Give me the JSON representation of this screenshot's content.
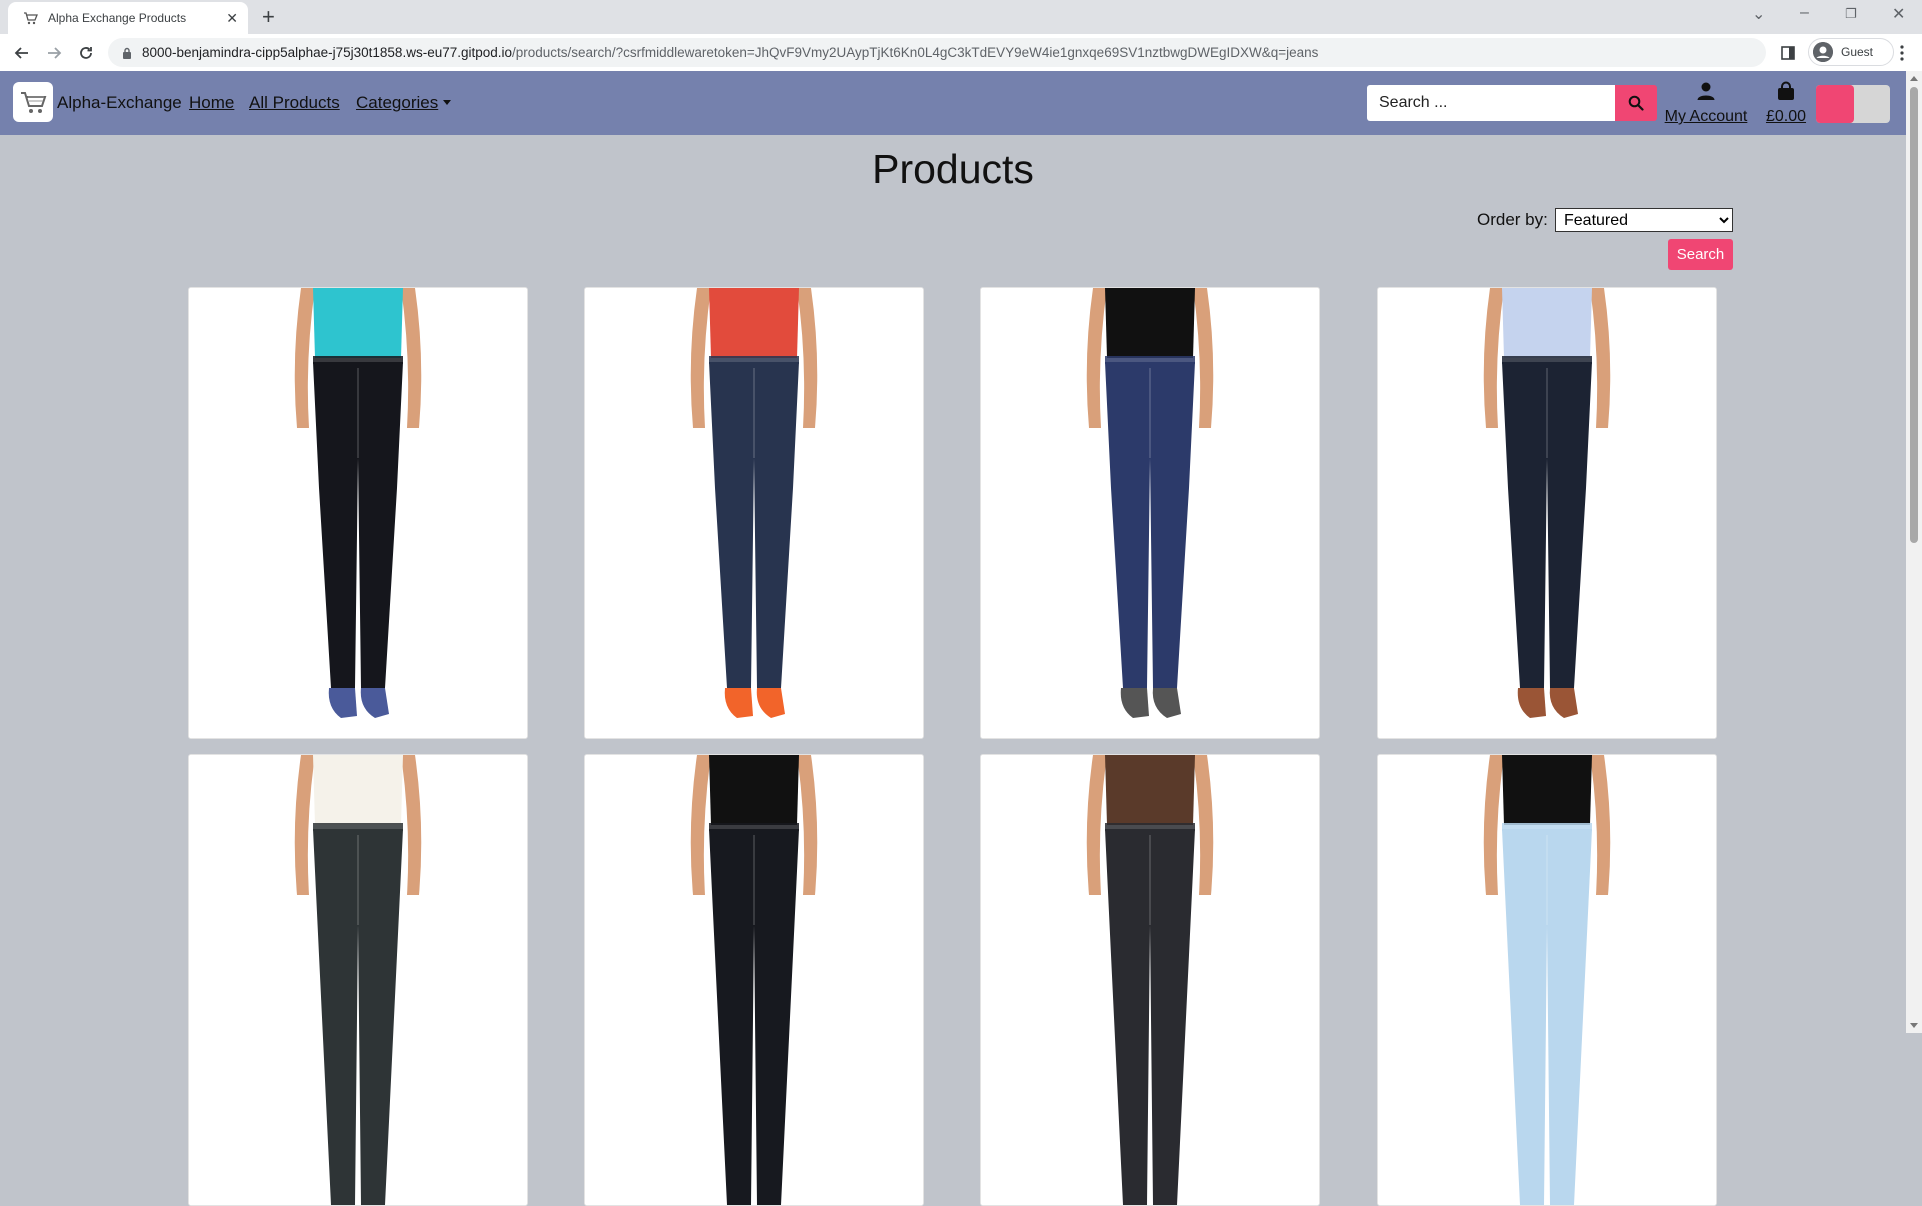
{
  "browser": {
    "tab_title": "Alpha Exchange Products",
    "new_tab": "+",
    "url_host": "8000-benjamindra-cipp5alphae-j75j30t1858.ws-eu77.gitpod.io",
    "url_rest": "/products/search/?csrfmiddlewaretoken=JhQvF9Vmy2UAypTjKt6Kn0L4gC3kTdEVY9eW4ie1gnxqe69SV1nztbwgDWEgIDXW&q=jeans",
    "profile_label": "Guest"
  },
  "nav": {
    "brand": "Alpha-Exchange",
    "links": [
      "Home",
      "All Products",
      "Categories"
    ],
    "search_placeholder": "Search ...",
    "account_label": "My Account",
    "bag_total": "£0.00",
    "accent_color": "#f04673",
    "nav_color": "#7581ad"
  },
  "main": {
    "heading": "Products",
    "order_label": "Order by:",
    "order_selected": "Featured",
    "order_button": "Search"
  },
  "products": [
    {
      "top_color": "#2ec4cf",
      "jeans_color": "#15161c",
      "shoe_color": "#4a5a9a"
    },
    {
      "top_color": "#e24b3c",
      "jeans_color": "#28344f",
      "shoe_color": "#f2642a"
    },
    {
      "top_color": "#111111",
      "jeans_color": "#2c3a6a",
      "shoe_color": "#555555"
    },
    {
      "top_color": "#c5d3ee",
      "jeans_color": "#1c2333",
      "shoe_color": "#9a5536"
    },
    {
      "top_color": "#f5f2ea",
      "jeans_color": "#2e3436",
      "shoe_color": "#333333"
    },
    {
      "top_color": "#111111",
      "jeans_color": "#17191f",
      "shoe_color": "#333333"
    },
    {
      "top_color": "#5a3a2a",
      "jeans_color": "#2a2b30",
      "shoe_color": "#333333"
    },
    {
      "top_color": "#111111",
      "jeans_color": "#b9d7ee",
      "shoe_color": "#333333"
    }
  ]
}
